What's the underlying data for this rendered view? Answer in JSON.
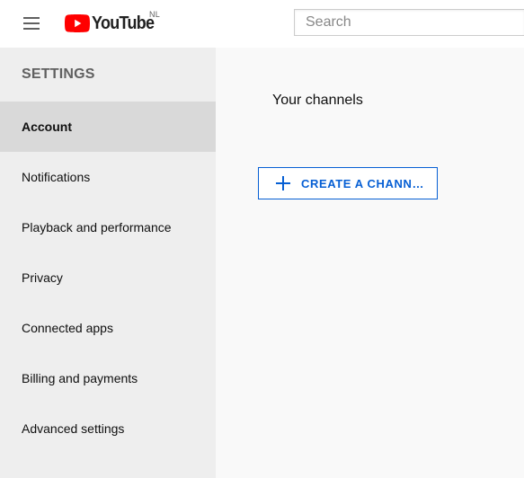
{
  "header": {
    "logo_text": "YouTube",
    "country_code": "NL",
    "search_placeholder": "Search",
    "logo_color": "#ff0000"
  },
  "sidebar": {
    "heading": "SETTINGS",
    "items": [
      {
        "label": "Account",
        "active": true
      },
      {
        "label": "Notifications",
        "active": false
      },
      {
        "label": "Playback and performance",
        "active": false
      },
      {
        "label": "Privacy",
        "active": false
      },
      {
        "label": "Connected apps",
        "active": false
      },
      {
        "label": "Billing and payments",
        "active": false
      },
      {
        "label": "Advanced settings",
        "active": false
      }
    ]
  },
  "main": {
    "section_title": "Your channels",
    "create_button_label": "CREATE A CHANN…",
    "accent_color": "#065fd4"
  }
}
